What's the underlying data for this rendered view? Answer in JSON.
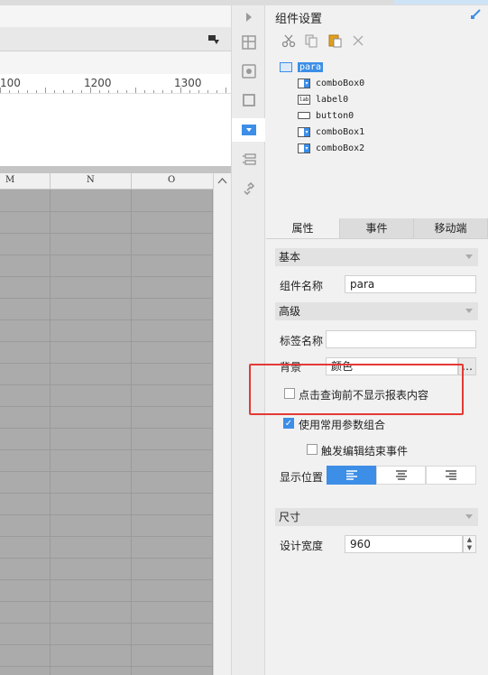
{
  "ruler": {
    "marks": [
      "100",
      "1200",
      "1300"
    ]
  },
  "columns": [
    "M",
    "N",
    "O"
  ],
  "panel": {
    "title": "组件设置",
    "toolbar_icons": [
      "cut-icon",
      "copy-icon",
      "paste-icon",
      "delete-icon"
    ],
    "tree": [
      {
        "label": "para",
        "icon": "form-icon",
        "selected": true
      },
      {
        "label": "comboBox0",
        "icon": "combobox-icon"
      },
      {
        "label": "label0",
        "icon": "label-icon"
      },
      {
        "label": "button0",
        "icon": "button-icon"
      },
      {
        "label": "comboBox1",
        "icon": "combobox-icon"
      },
      {
        "label": "comboBox2",
        "icon": "combobox-icon"
      }
    ],
    "tabs": [
      "属性",
      "事件",
      "移动端"
    ],
    "sections": {
      "basic": "基本",
      "advanced": "高级",
      "size": "尺寸"
    },
    "fields": {
      "name_label": "组件名称",
      "name_value": "para",
      "tag_label": "标签名称",
      "tag_value": "",
      "bg_label": "背景",
      "bg_value": "颜色",
      "bg_button": "…",
      "no_show_label": "点击查询前不显示报表内容",
      "no_show_checked": false,
      "use_common_label": "使用常用参数组合",
      "use_common_checked": true,
      "trigger_label": "触发编辑结束事件",
      "trigger_checked": false,
      "position_label": "显示位置",
      "position_selected": "left",
      "width_label": "设计宽度",
      "width_value": "960"
    }
  },
  "accent": "#3c8ee6",
  "highlight": "#e53935"
}
